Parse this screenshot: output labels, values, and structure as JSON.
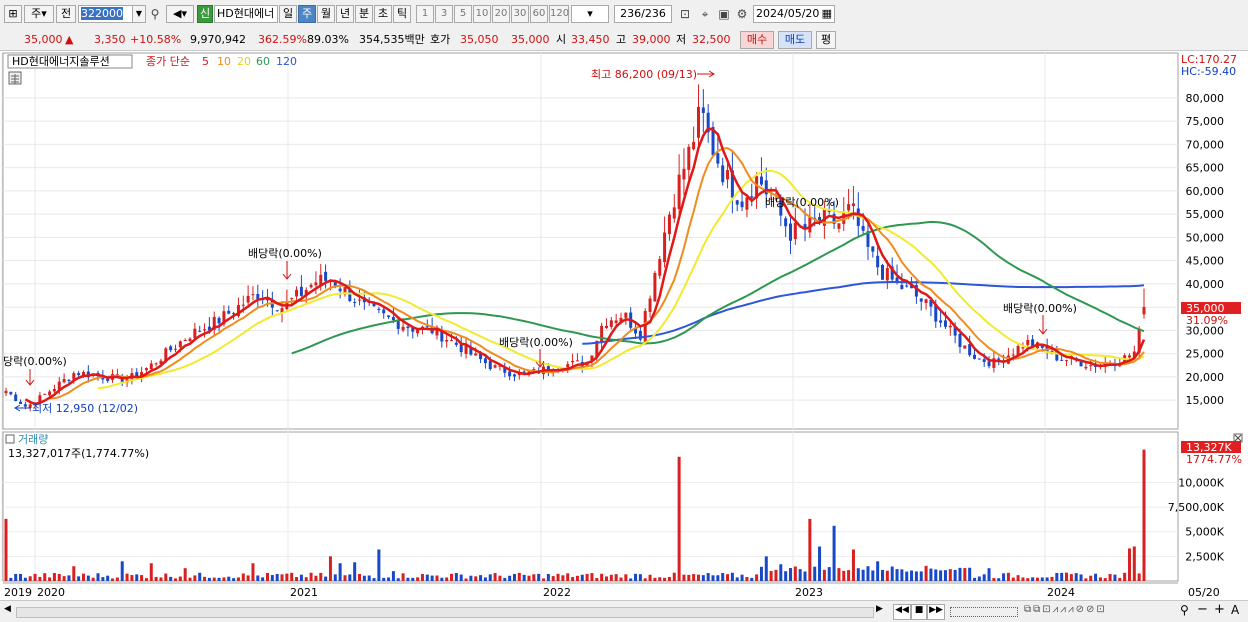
{
  "toolbar": {
    "tab_stock": "주",
    "tab_prev": "전",
    "code": "322000",
    "new_badge": "신",
    "stock_name": "HD현대에너",
    "periods": [
      "일",
      "주",
      "월",
      "년",
      "분",
      "초",
      "틱"
    ],
    "selected_period": "주",
    "nums": [
      "1",
      "3",
      "5",
      "10",
      "20",
      "30",
      "60",
      "120"
    ],
    "count": "236/236",
    "date": "2024/05/20",
    "icons": [
      "screen-icon",
      "dropdown-icon",
      "search-icon",
      "speaker-icon",
      "binoculars-icon",
      "crosshair-icon",
      "save-icon",
      "gear-icon",
      "calendar-icon"
    ]
  },
  "quote": {
    "price": "35,000",
    "change": "3,350",
    "rate": "+10.58%",
    "volume": "9,970,942",
    "vol_rate": "362.59%",
    "strength": "89.03%",
    "amount": "354,535백만",
    "bid_label": "호가",
    "bid1": "35,050",
    "bid2": "35,000",
    "open_label": "시",
    "open": "33,450",
    "high_label": "고",
    "high": "39,000",
    "low_label": "저",
    "low": "32,500",
    "buy_label": "매수",
    "sell_label": "매도",
    "avg_label": "평"
  },
  "legend": {
    "name": "HD현대에너지솔루션",
    "ma_title": "종가 단순",
    "ma_periods": [
      "5",
      "10",
      "20",
      "60",
      "120"
    ]
  },
  "colors": {
    "ma5": "#e01818",
    "ma10": "#f08c1c",
    "ma20": "#f2ea2e",
    "ma60": "#2e9850",
    "ma120": "#2e56d8",
    "up": "#d82020",
    "down": "#1848c8",
    "accent": "#4c86c6"
  },
  "chart_data": {
    "type": "candlestick",
    "price_axis": [
      "80,000",
      "75,000",
      "70,000",
      "65,000",
      "60,000",
      "55,000",
      "50,000",
      "45,000",
      "40,000",
      "35,000",
      "30,000",
      "25,000",
      "20,000",
      "15,000"
    ],
    "ylim": [
      10500,
      87500
    ],
    "corner_labels": {
      "lc": "LC:170.27",
      "hc": "HC:-59.40"
    },
    "current_price_tag": "35,000",
    "current_rate_tag": "31.09%",
    "annotations": {
      "high": "최고 86,200 (09/13)",
      "low": "최저 12,950 (12/02)",
      "dividend_1": "당락(0.00%)",
      "dividend_2": "배당락(0.00%)",
      "dividend_3": "배당락(0.00%)",
      "dividend_4": "배당락(0.00%)",
      "dividend_5": "배당락(0.00%)"
    },
    "x_axis": [
      "2019",
      "2020",
      "2021",
      "2022",
      "2023",
      "2024",
      "05/20"
    ],
    "key_prices": {
      "start": 17000,
      "low": 12950,
      "high": 86200,
      "close": 35000
    },
    "volume": {
      "title": "거래량",
      "value_label": "13,327,017주(1,774.77%)",
      "axis": [
        "10,000K",
        "7,500,00K",
        "5,000K",
        "2,500K"
      ],
      "axis_values": [
        10000,
        7500,
        5000,
        2500
      ],
      "tag_value": "13,327K",
      "tag_rate": "1774.77%",
      "last": 13327
    }
  },
  "bottom": {
    "nav_icons": [
      "scroll-end-icon",
      "rewind-icon",
      "stop-icon",
      "fast-forward-icon"
    ],
    "tool_icons": [
      "zoom-out-icon",
      "minus-icon",
      "plus-icon",
      "text-tool-icon"
    ],
    "tool_text": [
      "−",
      "+",
      "A"
    ]
  }
}
